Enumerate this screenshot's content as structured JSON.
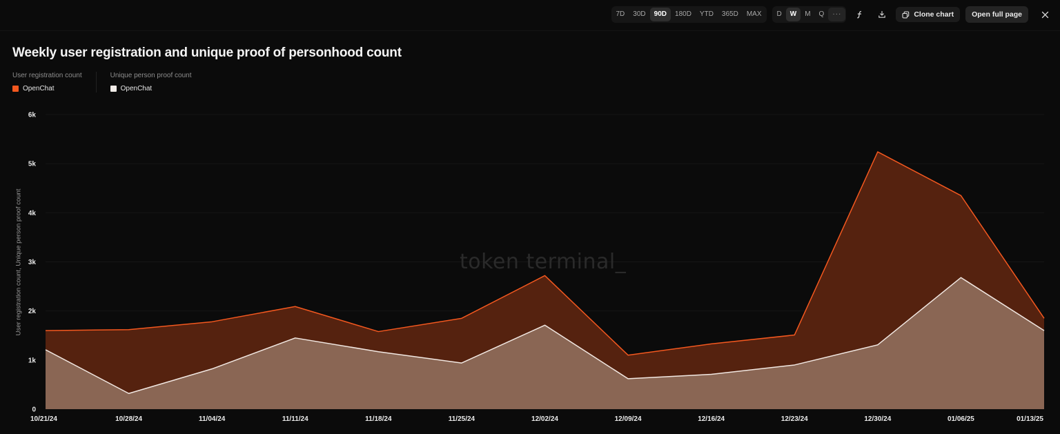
{
  "toolbar": {
    "ranges": [
      "7D",
      "30D",
      "90D",
      "180D",
      "YTD",
      "365D",
      "MAX"
    ],
    "active_range": "90D",
    "granularity": [
      "D",
      "W",
      "M",
      "Q"
    ],
    "active_granularity": "W",
    "more_label": "···",
    "clone_label": "Clone chart",
    "open_label": "Open full page"
  },
  "watermark": "token terminal_",
  "colors": {
    "registration": "#f4581f",
    "registration_fill": "#55220f",
    "proof_line": "#f2e8e2",
    "proof_fill": "#8a6654"
  },
  "chart_data": {
    "type": "area",
    "title": "Weekly user registration and unique proof of personhood count",
    "ylabel": "User registration count, Unique person proof count",
    "xlabel": "",
    "ylim": [
      0,
      6000
    ],
    "yticks": [
      "0",
      "1k",
      "2k",
      "3k",
      "4k",
      "5k",
      "6k"
    ],
    "ytick_values": [
      0,
      1000,
      2000,
      3000,
      4000,
      5000,
      6000
    ],
    "grid": true,
    "legend_position": "top-left",
    "legend_groups": [
      {
        "header": "User registration count",
        "entries": [
          "OpenChat"
        ]
      },
      {
        "header": "Unique person proof count",
        "entries": [
          "OpenChat"
        ]
      }
    ],
    "x": [
      "10/21/24",
      "10/28/24",
      "11/04/24",
      "11/11/24",
      "11/18/24",
      "11/25/24",
      "12/02/24",
      "12/09/24",
      "12/16/24",
      "12/23/24",
      "12/30/24",
      "01/06/25",
      "01/13/25"
    ],
    "series": [
      {
        "name": "OpenChat",
        "group": "User registration count",
        "values": [
          1600,
          1620,
          1780,
          2090,
          1580,
          1850,
          2720,
          1100,
          1330,
          1510,
          5240,
          4350,
          1850
        ]
      },
      {
        "name": "OpenChat",
        "group": "Unique person proof count",
        "values": [
          1210,
          320,
          820,
          1450,
          1170,
          940,
          1710,
          620,
          710,
          900,
          1310,
          2680,
          1600
        ]
      }
    ]
  }
}
